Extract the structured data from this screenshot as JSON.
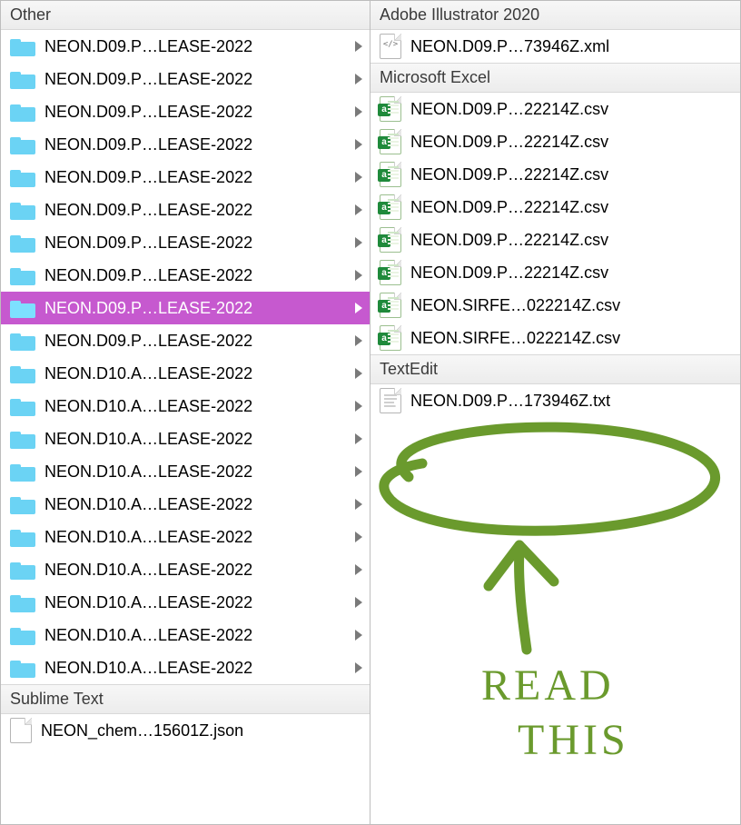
{
  "left": {
    "sections": [
      {
        "title": "Other",
        "items": [
          {
            "name": "NEON.D09.P…LEASE-2022",
            "type": "folder",
            "has_children": true,
            "selected": false
          },
          {
            "name": "NEON.D09.P…LEASE-2022",
            "type": "folder",
            "has_children": true,
            "selected": false
          },
          {
            "name": "NEON.D09.P…LEASE-2022",
            "type": "folder",
            "has_children": true,
            "selected": false
          },
          {
            "name": "NEON.D09.P…LEASE-2022",
            "type": "folder",
            "has_children": true,
            "selected": false
          },
          {
            "name": "NEON.D09.P…LEASE-2022",
            "type": "folder",
            "has_children": true,
            "selected": false
          },
          {
            "name": "NEON.D09.P…LEASE-2022",
            "type": "folder",
            "has_children": true,
            "selected": false
          },
          {
            "name": "NEON.D09.P…LEASE-2022",
            "type": "folder",
            "has_children": true,
            "selected": false
          },
          {
            "name": "NEON.D09.P…LEASE-2022",
            "type": "folder",
            "has_children": true,
            "selected": false
          },
          {
            "name": "NEON.D09.P…LEASE-2022",
            "type": "folder",
            "has_children": true,
            "selected": true
          },
          {
            "name": "NEON.D09.P…LEASE-2022",
            "type": "folder",
            "has_children": true,
            "selected": false
          },
          {
            "name": "NEON.D10.A…LEASE-2022",
            "type": "folder",
            "has_children": true,
            "selected": false
          },
          {
            "name": "NEON.D10.A…LEASE-2022",
            "type": "folder",
            "has_children": true,
            "selected": false
          },
          {
            "name": "NEON.D10.A…LEASE-2022",
            "type": "folder",
            "has_children": true,
            "selected": false
          },
          {
            "name": "NEON.D10.A…LEASE-2022",
            "type": "folder",
            "has_children": true,
            "selected": false
          },
          {
            "name": "NEON.D10.A…LEASE-2022",
            "type": "folder",
            "has_children": true,
            "selected": false
          },
          {
            "name": "NEON.D10.A…LEASE-2022",
            "type": "folder",
            "has_children": true,
            "selected": false
          },
          {
            "name": "NEON.D10.A…LEASE-2022",
            "type": "folder",
            "has_children": true,
            "selected": false
          },
          {
            "name": "NEON.D10.A…LEASE-2022",
            "type": "folder",
            "has_children": true,
            "selected": false
          },
          {
            "name": "NEON.D10.A…LEASE-2022",
            "type": "folder",
            "has_children": true,
            "selected": false
          },
          {
            "name": "NEON.D10.A…LEASE-2022",
            "type": "folder",
            "has_children": true,
            "selected": false
          }
        ]
      },
      {
        "title": "Sublime Text",
        "items": [
          {
            "name": "NEON_chem…15601Z.json",
            "type": "json",
            "has_children": false,
            "selected": false
          }
        ]
      }
    ]
  },
  "right": {
    "sections": [
      {
        "title": "Adobe Illustrator 2020",
        "items": [
          {
            "name": "NEON.D09.P…73946Z.xml",
            "type": "xml",
            "has_children": false,
            "selected": false
          }
        ]
      },
      {
        "title": "Microsoft Excel",
        "items": [
          {
            "name": "NEON.D09.P…22214Z.csv",
            "type": "csv",
            "has_children": false,
            "selected": false
          },
          {
            "name": "NEON.D09.P…22214Z.csv",
            "type": "csv",
            "has_children": false,
            "selected": false
          },
          {
            "name": "NEON.D09.P…22214Z.csv",
            "type": "csv",
            "has_children": false,
            "selected": false
          },
          {
            "name": "NEON.D09.P…22214Z.csv",
            "type": "csv",
            "has_children": false,
            "selected": false
          },
          {
            "name": "NEON.D09.P…22214Z.csv",
            "type": "csv",
            "has_children": false,
            "selected": false
          },
          {
            "name": "NEON.D09.P…22214Z.csv",
            "type": "csv",
            "has_children": false,
            "selected": false
          },
          {
            "name": "NEON.SIRFE…022214Z.csv",
            "type": "csv",
            "has_children": false,
            "selected": false
          },
          {
            "name": "NEON.SIRFE…022214Z.csv",
            "type": "csv",
            "has_children": false,
            "selected": false
          }
        ]
      },
      {
        "title": "TextEdit",
        "items": [
          {
            "name": "NEON.D09.P…173946Z.txt",
            "type": "txt",
            "has_children": false,
            "selected": false
          }
        ]
      }
    ]
  },
  "annotation": {
    "text1": "READ",
    "text2": "THIS",
    "color": "#6a9a2d"
  }
}
